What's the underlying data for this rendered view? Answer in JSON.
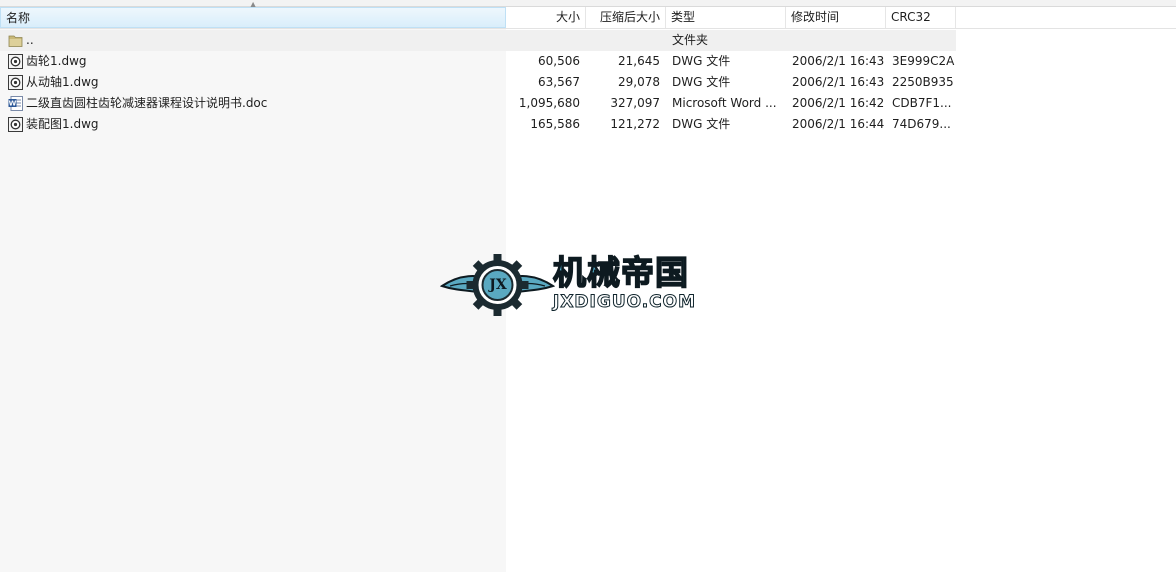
{
  "header": {
    "name": "名称",
    "size": "大小",
    "packed": "压缩后大小",
    "type": "类型",
    "modified": "修改时间",
    "crc": "CRC32"
  },
  "rows": [
    {
      "name": "..",
      "size": "",
      "packed": "",
      "type": "文件夹",
      "modified": "",
      "crc": "",
      "icon": "folder-icon"
    },
    {
      "name": "齿轮1.dwg",
      "size": "60,506",
      "packed": "21,645",
      "type": "DWG 文件",
      "modified": "2006/2/1 16:43",
      "crc": "3E999C2A",
      "icon": "dwg-file-icon"
    },
    {
      "name": "从动轴1.dwg",
      "size": "63,567",
      "packed": "29,078",
      "type": "DWG 文件",
      "modified": "2006/2/1 16:43",
      "crc": "2250B935",
      "icon": "dwg-file-icon"
    },
    {
      "name": "二级直齿圆柱齿轮减速器课程设计说明书.doc",
      "size": "1,095,680",
      "packed": "327,097",
      "type": "Microsoft Word ...",
      "modified": "2006/2/1 16:42",
      "crc": "CDB7F1...",
      "icon": "word-doc-icon"
    },
    {
      "name": "装配图1.dwg",
      "size": "165,586",
      "packed": "121,272",
      "type": "DWG 文件",
      "modified": "2006/2/1 16:44",
      "crc": "74D679...",
      "icon": "dwg-file-icon"
    }
  ],
  "watermark": {
    "title": "机械帝国",
    "subtitle": "JXDIGUO.COM",
    "badge": "JX"
  },
  "colors": {
    "header_active": "#d9eefb",
    "logo_blue": "#4fa9c4"
  }
}
